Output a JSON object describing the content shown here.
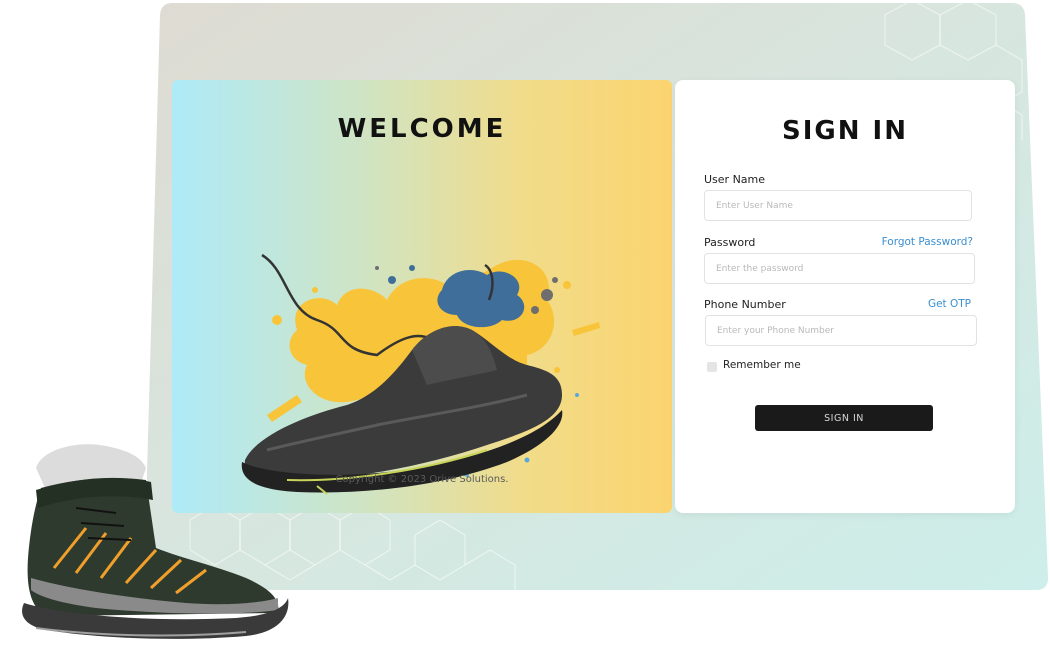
{
  "welcome": {
    "heading": "WELCOME",
    "image": "sneaker-with-paint-splash",
    "copyright": "Copyright © 2023 Orive Solutions."
  },
  "signin": {
    "title": "SIGN IN",
    "username": {
      "label": "User Name",
      "placeholder": "Enter User Name",
      "value": ""
    },
    "password": {
      "label": "Password",
      "placeholder": "Enter the password",
      "value": "",
      "forgot_link": "Forgot Password?"
    },
    "phone": {
      "label": "Phone Number",
      "placeholder": "Enter your Phone Number",
      "value": "",
      "otp_link": "Get OTP"
    },
    "remember_label": "Remember me",
    "remember_checked": false,
    "submit_label": "SIGN IN"
  },
  "colors": {
    "accent_link": "#3a8fd0",
    "button_bg": "#1a1a1a",
    "gradient_start": "#aeeaf8",
    "gradient_end": "#fbd46f"
  },
  "decor": {
    "boot_image": "hiking-boot"
  }
}
